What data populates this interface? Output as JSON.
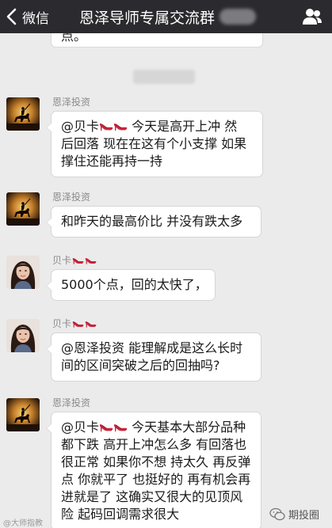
{
  "header": {
    "back_label": "微信",
    "title": "恩泽导师专属交流群",
    "colors": {
      "bar": "#2b2b2f",
      "text": "#ffffff"
    }
  },
  "top_partial": {
    "text": "点。"
  },
  "messages": [
    {
      "sender": "恩泽投资",
      "sender_heels": 0,
      "avatar": "horse-rider-sunset-avatar",
      "lines": [
        {
          "pre": "@贝卡",
          "heels": 2,
          "post": "今天是高开上冲 然"
        },
        {
          "pre": "后回落 现在在这有个小支撑 如果",
          "heels": 0,
          "post": ""
        },
        {
          "pre": "撑住还能再持一持",
          "heels": 0,
          "post": ""
        }
      ]
    },
    {
      "sender": "恩泽投资",
      "sender_heels": 0,
      "avatar": "horse-rider-sunset-avatar",
      "lines": [
        {
          "pre": "和昨天的最高价比 并没有跌太多",
          "heels": 0,
          "post": ""
        }
      ]
    },
    {
      "sender": "贝卡",
      "sender_heels": 2,
      "avatar": "woman-portrait-avatar",
      "lines": [
        {
          "pre": "5000个点，回的太快了，",
          "heels": 0,
          "post": ""
        }
      ]
    },
    {
      "sender": "贝卡",
      "sender_heels": 2,
      "avatar": "woman-portrait-avatar",
      "lines": [
        {
          "pre": "@恩泽投资 能理解成是这么长时",
          "heels": 0,
          "post": ""
        },
        {
          "pre": "间的区间突破之后的回抽吗?",
          "heels": 0,
          "post": ""
        }
      ]
    },
    {
      "sender": "恩泽投资",
      "sender_heels": 0,
      "avatar": "horse-rider-sunset-avatar",
      "lines": [
        {
          "pre": "@贝卡",
          "heels": 2,
          "post": "今天基本大部分品种"
        },
        {
          "pre": "都下跌 高开上冲怎么多 有回落也",
          "heels": 0,
          "post": ""
        },
        {
          "pre": "很正常 如果你不想 持太久 再反弹",
          "heels": 0,
          "post": ""
        },
        {
          "pre": "点 你就平了 也挺好的 再有机会再",
          "heels": 0,
          "post": ""
        },
        {
          "pre": "进就是了 这确实又很大的见顶风",
          "heels": 0,
          "post": ""
        },
        {
          "pre": "险 起码回调需求很大",
          "heels": 0,
          "post": ""
        }
      ]
    }
  ],
  "watermark_right": "期投圈",
  "watermark_left": "@大师指教"
}
